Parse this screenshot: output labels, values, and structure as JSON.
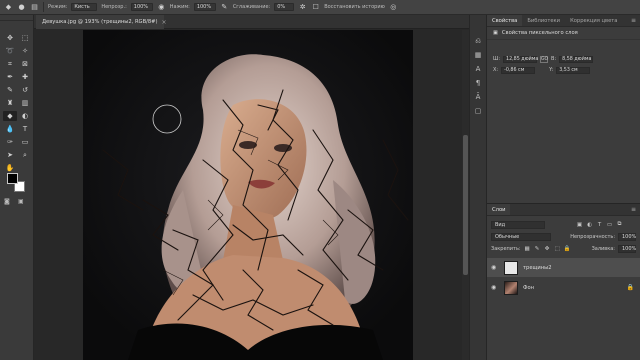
{
  "options_bar": {
    "mode_label": "Режим:",
    "mode_value": "Кисть",
    "opacity_label": "Непрозр.:",
    "opacity_value": "100%",
    "flow_label": "Нажим:",
    "flow_value": "100%",
    "smoothing_label": "Сглаживание:",
    "smoothing_value": "0%",
    "history_label": "Восстановить историю"
  },
  "document_tab": {
    "title": "Девушка.jpg @ 193% (трещины2, RGB/8#)",
    "close": "×"
  },
  "properties": {
    "tabs": [
      "Свойства",
      "Библиотеки",
      "Коррекция цвета"
    ],
    "header": "Свойства пиксельного слоя",
    "w_label": "Ш:",
    "w_value": "12,85 дюйма",
    "link_label": "GO",
    "h_label": "В:",
    "h_value": "8,58 дюйма",
    "x_label": "X:",
    "x_value": "-0,86 см",
    "y_label": "Y:",
    "y_value": "3,53 см"
  },
  "layers": {
    "tab": "Слои",
    "filter_value": "Вид",
    "blend_mode": "Обычные",
    "opacity_label": "Непрозрачность:",
    "opacity_value": "100%",
    "lock_label": "Закрепить:",
    "fill_label": "Заливка:",
    "fill_value": "100%",
    "items": [
      {
        "name": "трещины2",
        "selected": true
      },
      {
        "name": "Фон",
        "selected": false
      }
    ]
  },
  "colors": {
    "foreground": "#000000",
    "background": "#ffffff",
    "ui_dark": "#282828",
    "panel": "#3c3c3c"
  }
}
